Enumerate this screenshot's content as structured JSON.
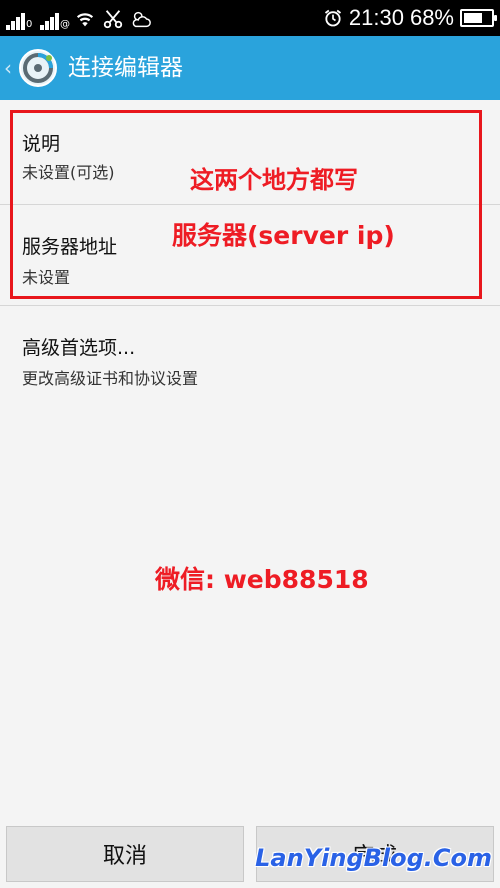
{
  "status_bar": {
    "sim1": "0",
    "sim2": "@",
    "time": "21:30",
    "battery_percent": "68%",
    "battery_level": 0.68,
    "icons": [
      "signal-icon",
      "signal-icon",
      "wifi-icon",
      "scissors-icon",
      "weather-icon",
      "alarm-icon",
      "battery-icon"
    ]
  },
  "action_bar": {
    "title": "连接编辑器",
    "back_glyph": "‹",
    "color": "#2aa3dc"
  },
  "preferences": [
    {
      "title": "说明",
      "summary": "未设置(可选)"
    },
    {
      "title": "服务器地址",
      "summary": "未设置"
    },
    {
      "title": "高级首选项...",
      "summary": "更改高级证书和协议设置"
    }
  ],
  "annotations": {
    "line1": "这两个地方都写",
    "line2": "服务器(server ip)",
    "wechat": "微信: web88518",
    "color": "#ee1c24"
  },
  "buttons": {
    "cancel": "取消",
    "done": "完成"
  },
  "watermark": "LanYingBlog.Com"
}
